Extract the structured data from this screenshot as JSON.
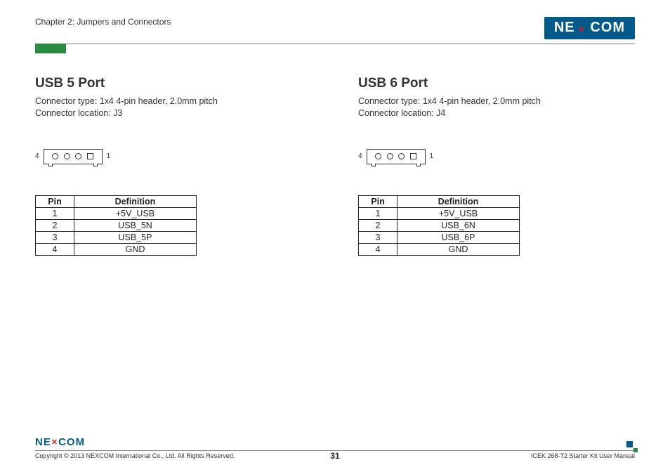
{
  "header": {
    "chapter": "Chapter 2: Jumpers and Connectors",
    "logo_text": "NEXCOM"
  },
  "ports": [
    {
      "title": "USB 5 Port",
      "type_line": "Connector type: 1x4 4-pin header, 2.0mm pitch",
      "loc_line": "Connector location: J3",
      "fig_left": "4",
      "fig_right": "1",
      "table": {
        "headers": [
          "Pin",
          "Definition"
        ],
        "rows": [
          [
            "1",
            "+5V_USB"
          ],
          [
            "2",
            "USB_5N"
          ],
          [
            "3",
            "USB_5P"
          ],
          [
            "4",
            "GND"
          ]
        ]
      }
    },
    {
      "title": "USB 6 Port",
      "type_line": "Connector type: 1x4 4-pin header, 2.0mm pitch",
      "loc_line": "Connector location: J4",
      "fig_left": "4",
      "fig_right": "1",
      "table": {
        "headers": [
          "Pin",
          "Definition"
        ],
        "rows": [
          [
            "1",
            "+5V_USB"
          ],
          [
            "2",
            "USB_6N"
          ],
          [
            "3",
            "USB_6P"
          ],
          [
            "4",
            "GND"
          ]
        ]
      }
    }
  ],
  "footer": {
    "logo_text": "NEXCOM",
    "copyright": "Copyright © 2013 NEXCOM International Co., Ltd. All Rights Reserved.",
    "page": "31",
    "manual": "ICEK 268-T2 Starter Kit User Manual"
  }
}
